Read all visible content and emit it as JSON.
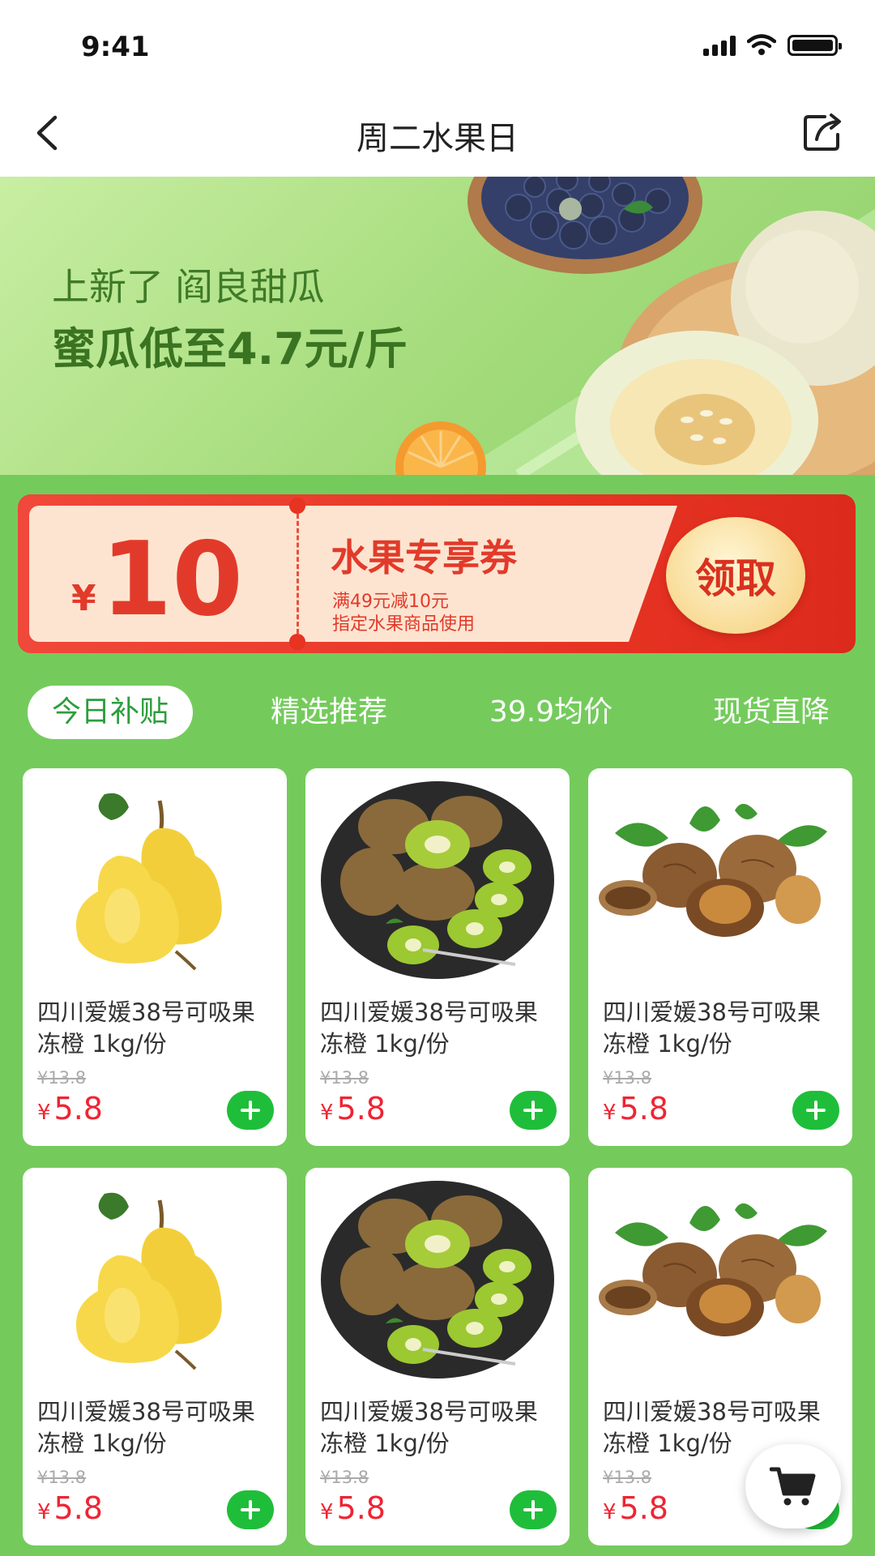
{
  "status_bar": {
    "time": "9:41"
  },
  "navbar": {
    "title": "周二水果日"
  },
  "banner": {
    "line1": "上新了 阎良甜瓜",
    "line2": "蜜瓜低至4.7元/斤"
  },
  "coupon": {
    "currency": "¥",
    "amount": "10",
    "title": "水果专享券",
    "desc1": "满49元减10元",
    "desc2": "指定水果商品使用",
    "button": "领取"
  },
  "tabs": [
    {
      "label": "今日补贴",
      "active": true
    },
    {
      "label": "精选推荐",
      "active": false
    },
    {
      "label": "39.9均价",
      "active": false
    },
    {
      "label": "现货直降",
      "active": false
    }
  ],
  "products": [
    {
      "image": "pear-image",
      "name": "四川爱媛38号可吸果冻橙 1kg/份",
      "old_price": "¥13.8",
      "currency": "¥",
      "price": "5.8"
    },
    {
      "image": "kiwi-image",
      "name": "四川爱媛38号可吸果冻橙 1kg/份",
      "old_price": "¥13.8",
      "currency": "¥",
      "price": "5.8"
    },
    {
      "image": "walnut-image",
      "name": "四川爱媛38号可吸果冻橙 1kg/份",
      "old_price": "¥13.8",
      "currency": "¥",
      "price": "5.8"
    },
    {
      "image": "pear-image",
      "name": "四川爱媛38号可吸果冻橙 1kg/份",
      "old_price": "¥13.8",
      "currency": "¥",
      "price": "5.8"
    },
    {
      "image": "kiwi-image",
      "name": "四川爱媛38号可吸果冻橙 1kg/份",
      "old_price": "¥13.8",
      "currency": "¥",
      "price": "5.8"
    },
    {
      "image": "walnut-image",
      "name": "四川爱媛38号可吸果冻橙 1kg/份",
      "old_price": "¥13.8",
      "currency": "¥",
      "price": "5.8"
    }
  ],
  "colors": {
    "page_bg": "#74cb5c",
    "price": "#ef2433",
    "add_button": "#1fbe3a",
    "coupon_red": "#e63322",
    "active_tab_text": "#2c9e3c"
  },
  "icons": {
    "back": "chevron-left-icon",
    "share": "share-icon",
    "add": "plus-icon",
    "cart": "cart-icon"
  }
}
